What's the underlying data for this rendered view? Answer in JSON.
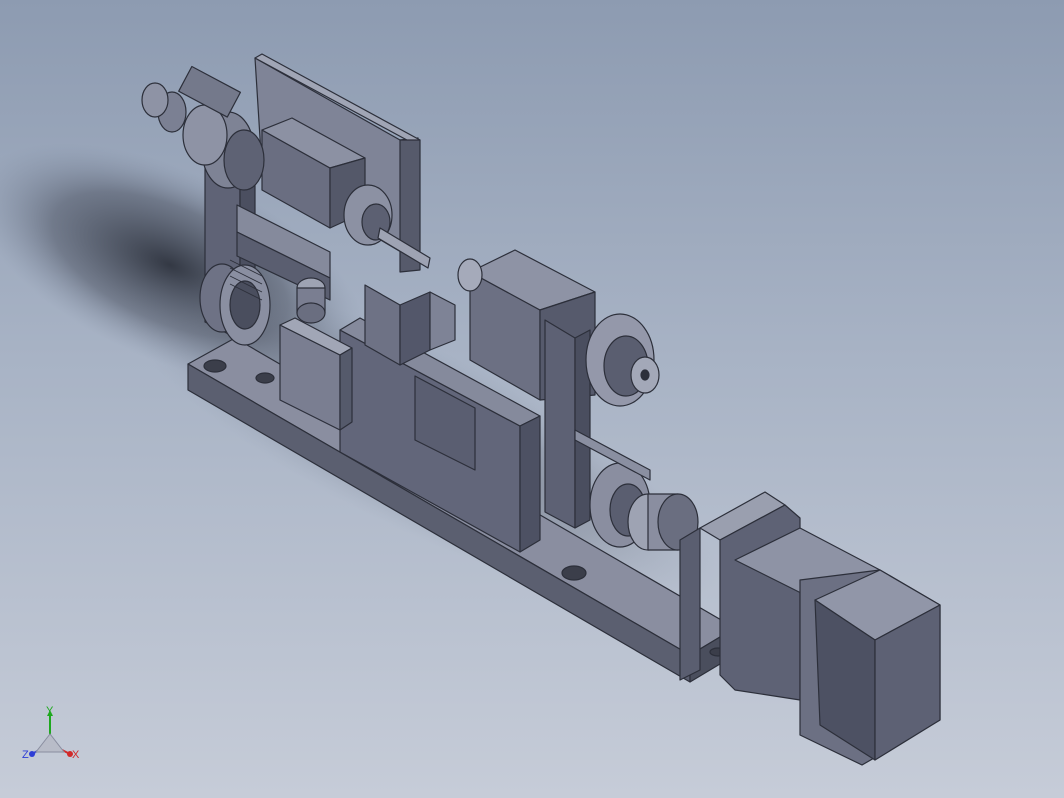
{
  "viewport": {
    "background_top": "#8d9bb1",
    "background_bottom": "#c6ccd8",
    "model_color": "#6c7083"
  },
  "triad": {
    "x_label": "X",
    "y_label": "Y",
    "z_label": "Z",
    "x_color": "#d12a2a",
    "y_color": "#1ea81e",
    "z_color": "#2e3ed6"
  }
}
